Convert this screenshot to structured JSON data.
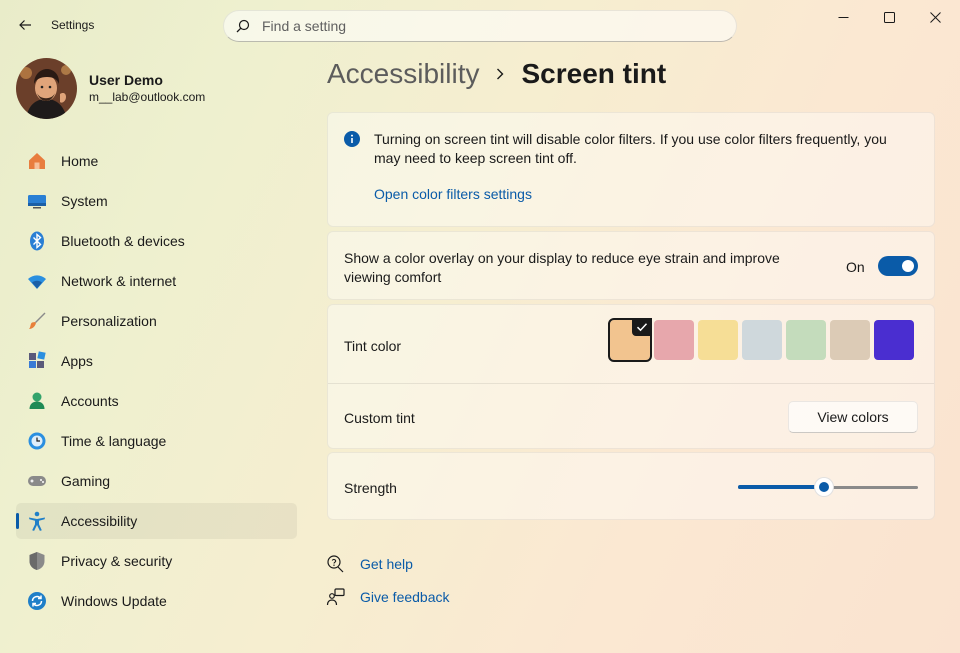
{
  "app": {
    "title": "Settings"
  },
  "search": {
    "placeholder": "Find a setting"
  },
  "user": {
    "name": "User Demo",
    "email": "m__lab@outlook.com"
  },
  "sidebar": {
    "items": [
      {
        "label": "Home",
        "icon": "home-icon"
      },
      {
        "label": "System",
        "icon": "system-icon"
      },
      {
        "label": "Bluetooth & devices",
        "icon": "bluetooth-icon"
      },
      {
        "label": "Network & internet",
        "icon": "wifi-icon"
      },
      {
        "label": "Personalization",
        "icon": "brush-icon"
      },
      {
        "label": "Apps",
        "icon": "apps-icon"
      },
      {
        "label": "Accounts",
        "icon": "accounts-icon"
      },
      {
        "label": "Time & language",
        "icon": "clock-globe-icon"
      },
      {
        "label": "Gaming",
        "icon": "gamepad-icon"
      },
      {
        "label": "Accessibility",
        "icon": "accessibility-icon",
        "active": true
      },
      {
        "label": "Privacy & security",
        "icon": "shield-icon"
      },
      {
        "label": "Windows Update",
        "icon": "update-icon"
      }
    ]
  },
  "breadcrumb": {
    "parent": "Accessibility",
    "current": "Screen tint"
  },
  "info": {
    "text": "Turning on screen tint will disable color filters. If you use color filters frequently, you may need to keep screen tint off.",
    "link": "Open color filters settings"
  },
  "overlay": {
    "text": "Show a color overlay on your display to reduce eye strain and improve viewing comfort",
    "state": "On",
    "enabled": true
  },
  "tint": {
    "label": "Tint color",
    "selected_index": 0,
    "swatches": [
      "#f2c48f",
      "#e7a7ac",
      "#f6de96",
      "#cfd8dc",
      "#c4dcbc",
      "#dccbb6",
      "#4a2ed0"
    ]
  },
  "custom_tint": {
    "label": "Custom tint",
    "button": "View colors"
  },
  "strength": {
    "label": "Strength",
    "value": 0.48
  },
  "help": {
    "get_help": "Get help",
    "feedback": "Give feedback"
  },
  "colors": {
    "accent": "#0a5ba8"
  }
}
